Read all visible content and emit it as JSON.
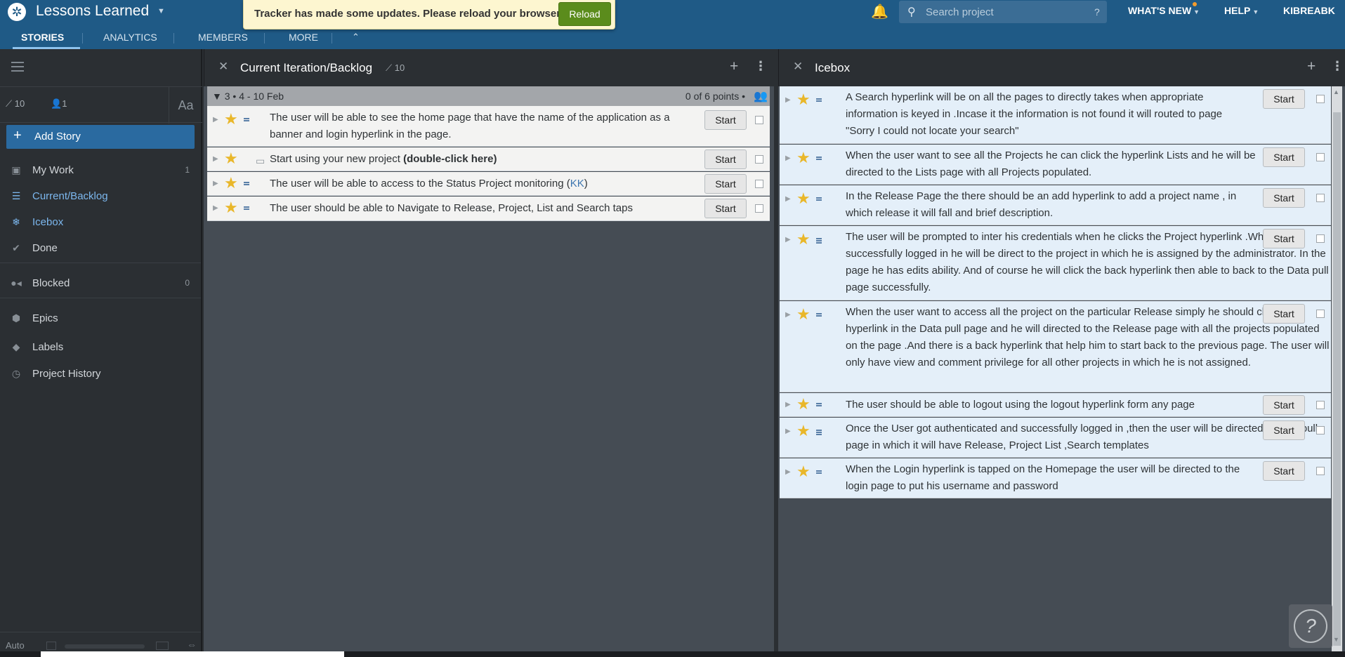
{
  "header": {
    "project_name": "Lessons Learned",
    "notice": "Tracker has made some updates. Please reload your browser.",
    "reload_label": "Reload",
    "search_placeholder": "Search project",
    "search_help": "?",
    "nav": {
      "whats_new": "WHAT'S NEW",
      "help": "HELP",
      "user": "KIBREABK"
    },
    "tabs": [
      "STORIES",
      "ANALYTICS",
      "MEMBERS",
      "MORE"
    ]
  },
  "sidebar": {
    "velocity": "10",
    "members": "1",
    "font_toggle": "Aa",
    "add_story": "Add Story",
    "items": [
      {
        "label": "My Work",
        "count": "1",
        "icon": "person-icon"
      },
      {
        "label": "Current/Backlog",
        "count": "",
        "icon": "list-icon"
      },
      {
        "label": "Icebox",
        "count": "",
        "icon": "snowflake-icon"
      },
      {
        "label": "Done",
        "count": "",
        "icon": "check-icon"
      },
      {
        "label": "Blocked",
        "count": "0",
        "icon": "blocked-icon"
      },
      {
        "label": "Epics",
        "count": "",
        "icon": "epic-icon"
      },
      {
        "label": "Labels",
        "count": "",
        "icon": "tag-icon"
      },
      {
        "label": "Project History",
        "count": "",
        "icon": "clock-icon"
      }
    ],
    "auto_label": "Auto"
  },
  "backlog": {
    "title": "Current Iteration/Backlog",
    "velocity": "10",
    "iteration_label": "3 • 4 - 10 Feb",
    "points_label": "0 of 6 points •",
    "stories": [
      {
        "text": "The user will be able to see the home page that have the name of the application as a banner and login hyperlink in the page.",
        "start": "Start"
      },
      {
        "text_pre": "Start using your new project ",
        "text_bold": "(double-click here)",
        "start": "Start"
      },
      {
        "text_pre": "The user will be able to access to the Status Project monitoring (",
        "owner": "KK",
        "text_post": ")",
        "start": "Start"
      },
      {
        "text": "The user should be able to Navigate to Release, Project, List and Search taps",
        "start": "Start"
      }
    ]
  },
  "icebox": {
    "title": "Icebox",
    "stories": [
      {
        "text": "A Search hyperlink will be on all the pages to directly takes when appropriate information is keyed in .Incase it the information is not found it will routed to page \"Sorry I could not locate your search\"",
        "start": "Start"
      },
      {
        "text": "When the user want to see all the Projects he can click the hyperlink Lists and he will be directed to the Lists page with all Projects populated.",
        "start": "Start"
      },
      {
        "text": "In the Release Page the there should be an add hyperlink to add a project name , in which release it will fall and brief description.",
        "start": "Start"
      },
      {
        "text": "The user will be prompted to inter his credentials when he clicks the Project hyperlink .When successfully logged in he will be direct to the project in which he is assigned by the administrator. In the page he has edits ability. And of course he will click the back hyperlink then able to back to the Data pull page successfully.",
        "start": "Start"
      },
      {
        "text": "When the user want to access all the project on the particular Release simply he should click the hyperlink in the Data pull page and he will directed to the Release page with all the projects populated on the page .And there is a back hyperlink that help him to start back to the previous page. The user will only have view and comment privilege for all other projects in which he is not assigned.",
        "start": "Start"
      },
      {
        "text": "The user should be able to logout using the logout hyperlink form any page",
        "start": "Start"
      },
      {
        "text": "Once the User got authenticated and successfully logged in ,then the user will be directed to data pull page in which it will have Release, Project List ,Search templates",
        "start": "Start"
      },
      {
        "text": "When the Login hyperlink is tapped on the Homepage the user will be directed to the login page to put his username and password",
        "start": "Start"
      }
    ]
  },
  "colors": {
    "header": "#1f5a86",
    "accent": "#2a6aa0",
    "reload": "#5b8c1c",
    "star": "#e9b72a",
    "icebox_row": "#e4eff9"
  }
}
